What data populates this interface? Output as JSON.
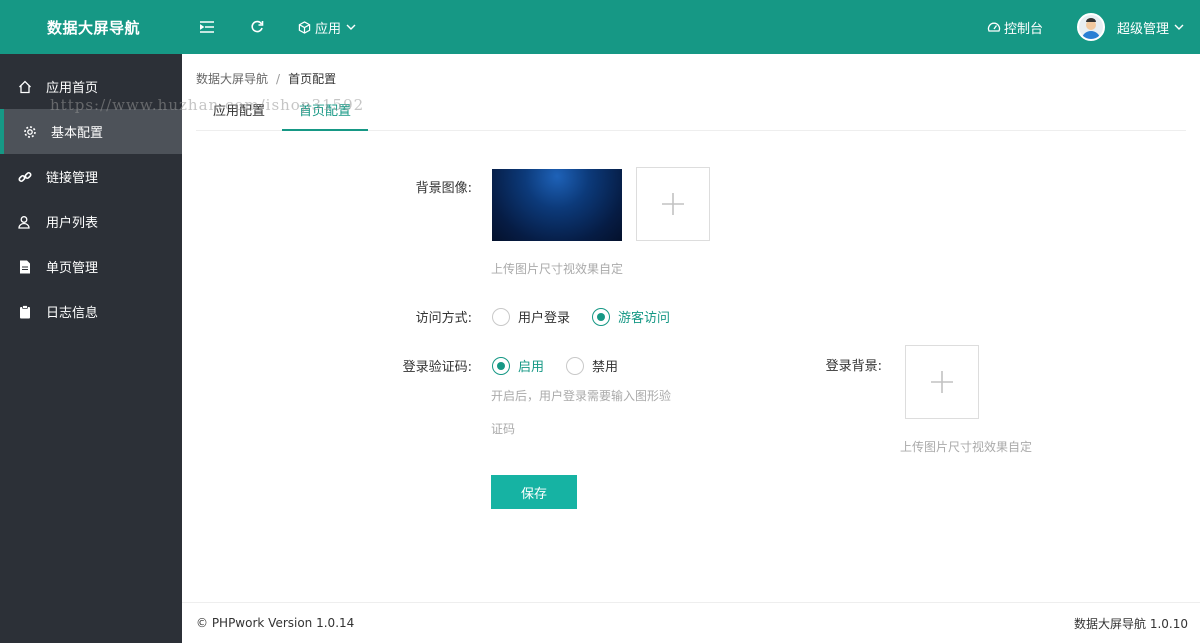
{
  "header": {
    "brand": "数据大屏导航",
    "app_menu_label": "应用",
    "console_label": "控制台",
    "user_name": "超级管理"
  },
  "sidebar": {
    "items": [
      {
        "label": "应用首页",
        "icon": "home-icon"
      },
      {
        "label": "基本配置",
        "icon": "gear-icon",
        "active": true
      },
      {
        "label": "链接管理",
        "icon": "link-icon"
      },
      {
        "label": "用户列表",
        "icon": "user-icon"
      },
      {
        "label": "单页管理",
        "icon": "document-icon"
      },
      {
        "label": "日志信息",
        "icon": "clipboard-icon"
      }
    ]
  },
  "breadcrumb": {
    "root": "数据大屏导航",
    "separator": "/",
    "current": "首页配置"
  },
  "tabs": [
    {
      "label": "应用配置"
    },
    {
      "label": "首页配置",
      "active": true
    }
  ],
  "form": {
    "bg_image_label": "背景图像:",
    "bg_image_hint": "上传图片尺寸视效果自定",
    "access_label": "访问方式:",
    "access_options": [
      {
        "label": "用户登录",
        "checked": false
      },
      {
        "label": "游客访问",
        "checked": true
      }
    ],
    "captcha_label": "登录验证码:",
    "captcha_options": [
      {
        "label": "启用",
        "checked": true
      },
      {
        "label": "禁用",
        "checked": false
      }
    ],
    "captcha_hint_line1": "开启后，用户登录需要输入图形验",
    "captcha_hint_line2": "证码",
    "login_bg_label": "登录背景:",
    "login_bg_hint": "上传图片尺寸视效果自定",
    "save_label": "保存"
  },
  "watermark": "https://www.huzhan.com/ishop31592",
  "footer": {
    "left": "© PHPwork Version 1.0.14",
    "right": "数据大屏导航 1.0.10"
  },
  "colors": {
    "primary": "#169885",
    "sidebar_bg": "#2c3037",
    "sidebar_active": "#4d5259",
    "save_button": "#16b3a3"
  }
}
